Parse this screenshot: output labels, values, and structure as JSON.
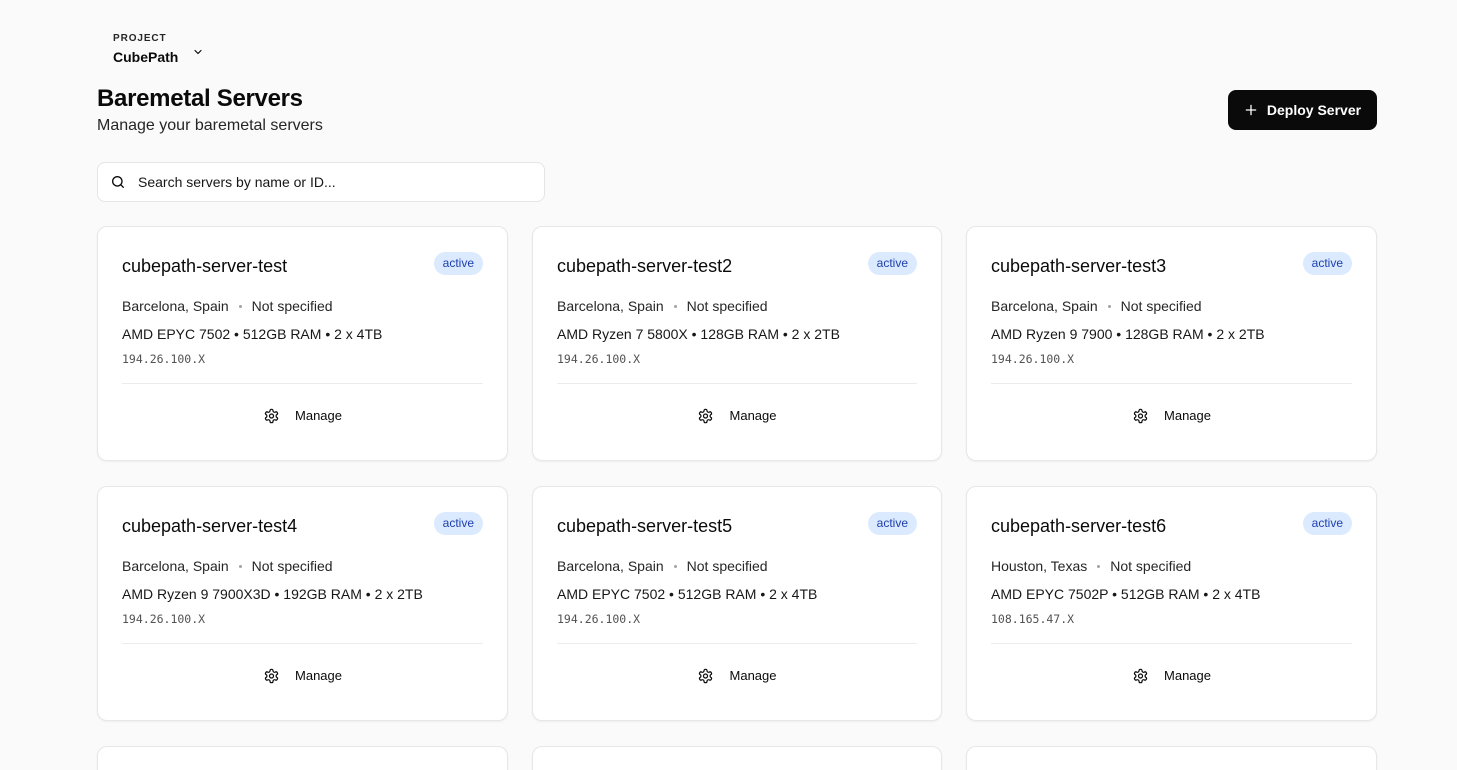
{
  "project": {
    "label": "PROJECT",
    "name": "CubePath"
  },
  "header": {
    "title": "Baremetal Servers",
    "subtitle": "Manage your baremetal servers"
  },
  "deploy_button": {
    "label": "Deploy Server"
  },
  "search": {
    "placeholder": "Search servers by name or ID...",
    "value": ""
  },
  "servers": [
    {
      "name": "cubepath-server-test",
      "status": "active",
      "location": "Barcelona, Spain",
      "note": "Not specified",
      "specs": "AMD EPYC 7502 • 512GB RAM • 2 x 4TB",
      "ip": "194.26.100.X",
      "action": "Manage"
    },
    {
      "name": "cubepath-server-test2",
      "status": "active",
      "location": "Barcelona, Spain",
      "note": "Not specified",
      "specs": "AMD Ryzen 7 5800X • 128GB RAM • 2 x 2TB",
      "ip": "194.26.100.X",
      "action": "Manage"
    },
    {
      "name": "cubepath-server-test3",
      "status": "active",
      "location": "Barcelona, Spain",
      "note": "Not specified",
      "specs": "AMD Ryzen 9 7900 • 128GB RAM • 2 x 2TB",
      "ip": "194.26.100.X",
      "action": "Manage"
    },
    {
      "name": "cubepath-server-test4",
      "status": "active",
      "location": "Barcelona, Spain",
      "note": "Not specified",
      "specs": "AMD Ryzen 9 7900X3D • 192GB RAM • 2 x 2TB",
      "ip": "194.26.100.X",
      "action": "Manage"
    },
    {
      "name": "cubepath-server-test5",
      "status": "active",
      "location": "Barcelona, Spain",
      "note": "Not specified",
      "specs": "AMD EPYC 7502 • 512GB RAM • 2 x 4TB",
      "ip": "194.26.100.X",
      "action": "Manage"
    },
    {
      "name": "cubepath-server-test6",
      "status": "active",
      "location": "Houston, Texas",
      "note": "Not specified",
      "specs": "AMD EPYC 7502P • 512GB RAM • 2 x 4TB",
      "ip": "108.165.47.X",
      "action": "Manage"
    }
  ],
  "icons": {
    "project_toggle": "chevron-down-icon",
    "deploy": "plus-icon",
    "search": "search-icon",
    "manage": "gear-icon"
  },
  "colors": {
    "primary_button": "#0a0a0a",
    "status_badge_bg": "#dbeafe",
    "status_badge_text": "#1e40af"
  }
}
